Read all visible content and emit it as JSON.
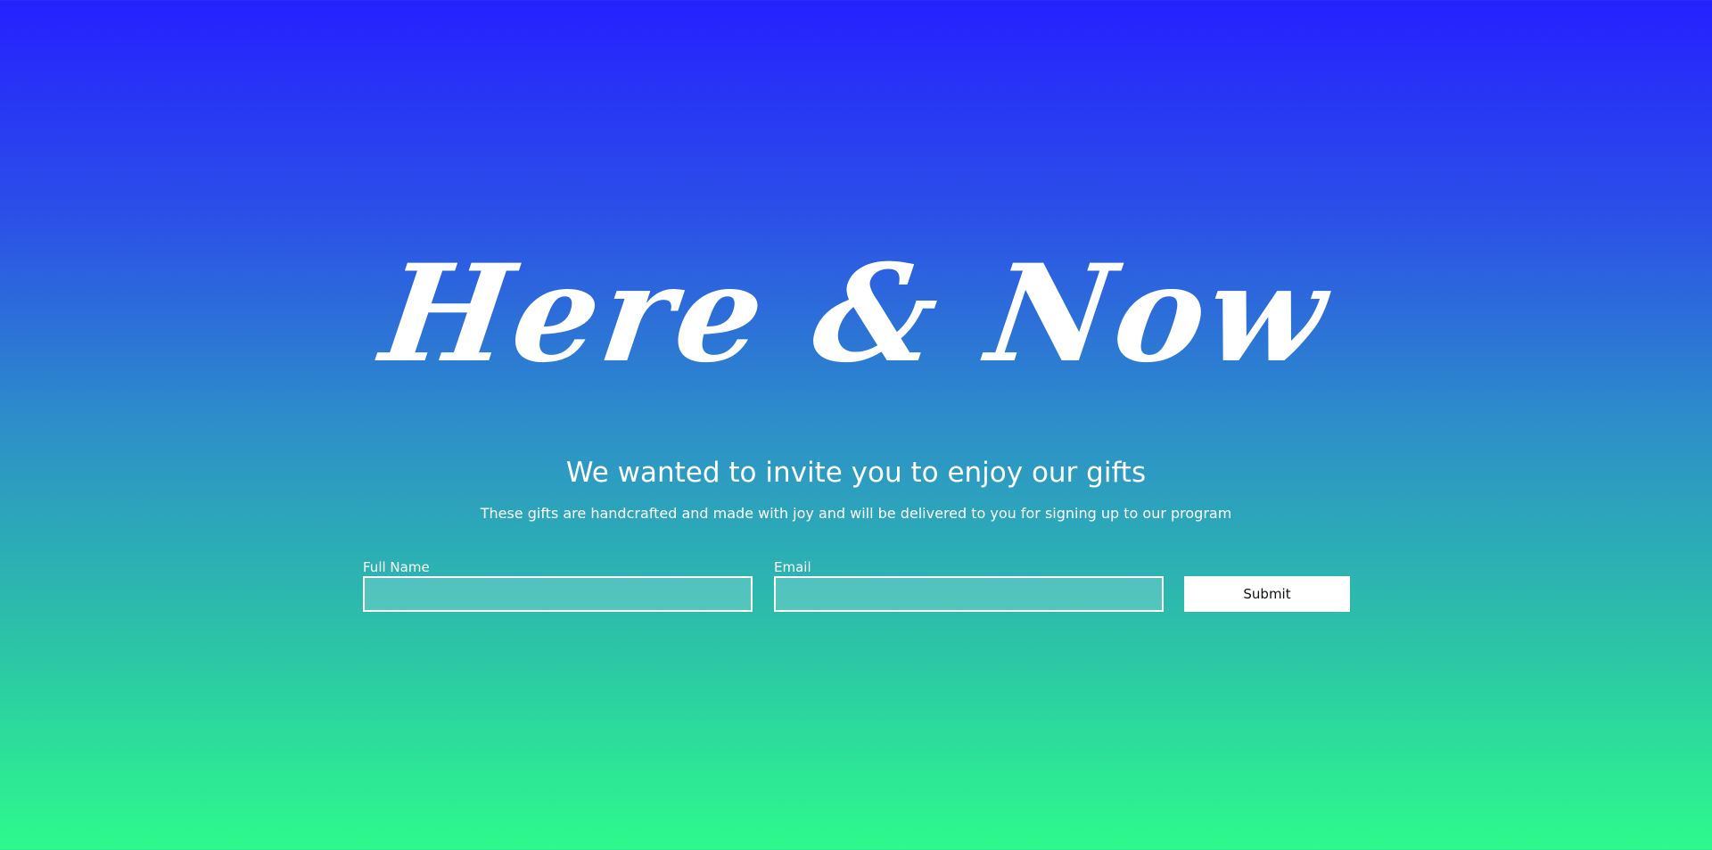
{
  "hero": {
    "title": "Here & Now",
    "subtitle": "We wanted to invite you to enjoy our gifts",
    "tagline": "These gifts are handcrafted and made with joy and will be delivered to you for signing up to our program"
  },
  "form": {
    "full_name_label": "Full Name",
    "full_name_value": "",
    "email_label": "Email",
    "email_value": "",
    "submit_label": "Submit"
  },
  "colors": {
    "gradient_top": "#2521ff",
    "gradient_bottom": "#2dfa8c",
    "text": "#ffffff",
    "button_bg": "#ffffff",
    "button_text": "#111111"
  }
}
